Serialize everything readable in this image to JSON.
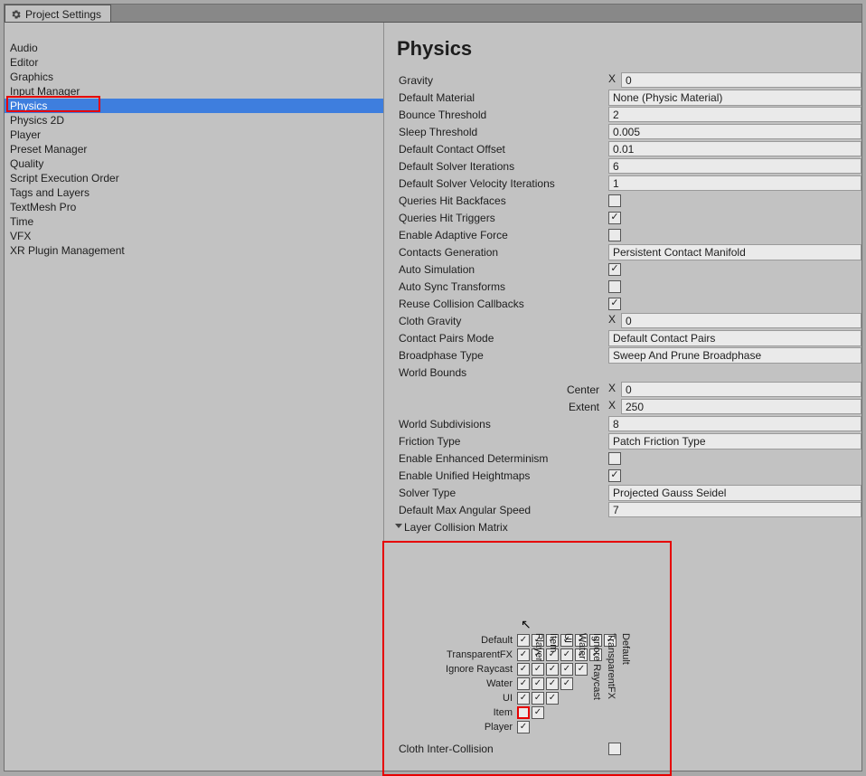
{
  "tab": {
    "title": "Project Settings"
  },
  "sidebar": {
    "items": [
      {
        "label": "Audio"
      },
      {
        "label": "Editor"
      },
      {
        "label": "Graphics"
      },
      {
        "label": "Input Manager"
      },
      {
        "label": "Physics",
        "selected": true
      },
      {
        "label": "Physics 2D"
      },
      {
        "label": "Player"
      },
      {
        "label": "Preset Manager"
      },
      {
        "label": "Quality"
      },
      {
        "label": "Script Execution Order"
      },
      {
        "label": "Tags and Layers"
      },
      {
        "label": "TextMesh Pro"
      },
      {
        "label": "Time"
      },
      {
        "label": "VFX"
      },
      {
        "label": "XR Plugin Management"
      }
    ]
  },
  "heading": "Physics",
  "props": {
    "gravity_label": "Gravity",
    "gravity_x_label": "X",
    "gravity_x": "0",
    "default_material_label": "Default Material",
    "default_material": "None (Physic Material)",
    "bounce_threshold_label": "Bounce Threshold",
    "bounce_threshold": "2",
    "sleep_threshold_label": "Sleep Threshold",
    "sleep_threshold": "0.005",
    "default_contact_offset_label": "Default Contact Offset",
    "default_contact_offset": "0.01",
    "default_solver_iterations_label": "Default Solver Iterations",
    "default_solver_iterations": "6",
    "default_solver_velocity_iterations_label": "Default Solver Velocity Iterations",
    "default_solver_velocity_iterations": "1",
    "queries_hit_backfaces_label": "Queries Hit Backfaces",
    "queries_hit_backfaces": false,
    "queries_hit_triggers_label": "Queries Hit Triggers",
    "queries_hit_triggers": true,
    "enable_adaptive_force_label": "Enable Adaptive Force",
    "enable_adaptive_force": false,
    "contacts_generation_label": "Contacts Generation",
    "contacts_generation": "Persistent Contact Manifold",
    "auto_simulation_label": "Auto Simulation",
    "auto_simulation": true,
    "auto_sync_transforms_label": "Auto Sync Transforms",
    "auto_sync_transforms": false,
    "reuse_collision_callbacks_label": "Reuse Collision Callbacks",
    "reuse_collision_callbacks": true,
    "cloth_gravity_label": "Cloth Gravity",
    "cloth_gravity_x_label": "X",
    "cloth_gravity_x": "0",
    "contact_pairs_mode_label": "Contact Pairs Mode",
    "contact_pairs_mode": "Default Contact Pairs",
    "broadphase_type_label": "Broadphase Type",
    "broadphase_type": "Sweep And Prune Broadphase",
    "world_bounds_label": "World Bounds",
    "world_center_label": "Center",
    "world_center_x_label": "X",
    "world_center_x": "0",
    "world_extent_label": "Extent",
    "world_extent_x_label": "X",
    "world_extent_x": "250",
    "world_subdivisions_label": "World Subdivisions",
    "world_subdivisions": "8",
    "friction_type_label": "Friction Type",
    "friction_type": "Patch Friction Type",
    "enable_enhanced_determinism_label": "Enable Enhanced Determinism",
    "enable_enhanced_determinism": false,
    "enable_unified_heightmaps_label": "Enable Unified Heightmaps",
    "enable_unified_heightmaps": true,
    "solver_type_label": "Solver Type",
    "solver_type": "Projected Gauss Seidel",
    "default_max_angular_speed_label": "Default Max Angular Speed",
    "default_max_angular_speed": "7",
    "layer_collision_matrix_label": "Layer Collision Matrix",
    "cloth_inter_collision_label": "Cloth Inter-Collision",
    "cloth_inter_collision": false
  },
  "matrix": {
    "columns": [
      "Player",
      "Item",
      "UI",
      "Water",
      "Ignore Raycast",
      "TransparentFX",
      "Default"
    ],
    "rows": [
      {
        "label": "Default",
        "cells": [
          true,
          true,
          true,
          true,
          true,
          true,
          true
        ]
      },
      {
        "label": "TransparentFX",
        "cells": [
          true,
          true,
          true,
          true,
          true,
          true
        ]
      },
      {
        "label": "Ignore Raycast",
        "cells": [
          true,
          true,
          true,
          true,
          true
        ]
      },
      {
        "label": "Water",
        "cells": [
          true,
          true,
          true,
          true
        ]
      },
      {
        "label": "UI",
        "cells": [
          true,
          true,
          true
        ]
      },
      {
        "label": "Item",
        "cells": [
          false,
          true
        ],
        "red_outline_index": 0
      },
      {
        "label": "Player",
        "cells": [
          true
        ]
      }
    ]
  }
}
